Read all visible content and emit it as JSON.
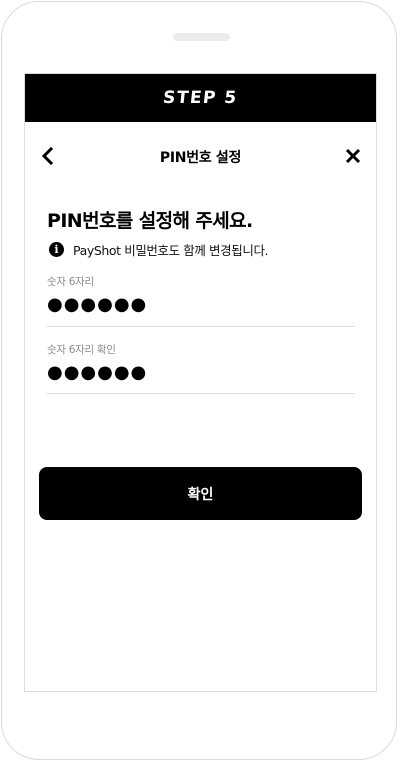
{
  "step_bar": {
    "label": "STEP 5"
  },
  "nav": {
    "title": "PIN번호 설정",
    "back_icon": "chevron-left-icon",
    "close_icon": "close-icon"
  },
  "content": {
    "heading": "PIN번호를 설정해 주세요.",
    "info_icon_glyph": "i",
    "info_text": "PayShot 비밀번호도 함께 변경됩니다."
  },
  "fields": [
    {
      "label": "숫자 6자리",
      "value": "●●●●●●"
    },
    {
      "label": "숫자 6자리 확인",
      "value": "●●●●●●"
    }
  ],
  "confirm_button": {
    "label": "확인"
  },
  "colors": {
    "primary": "#000000",
    "on_primary": "#ffffff",
    "label_gray": "#8c8c8c",
    "divider": "#dedede"
  }
}
